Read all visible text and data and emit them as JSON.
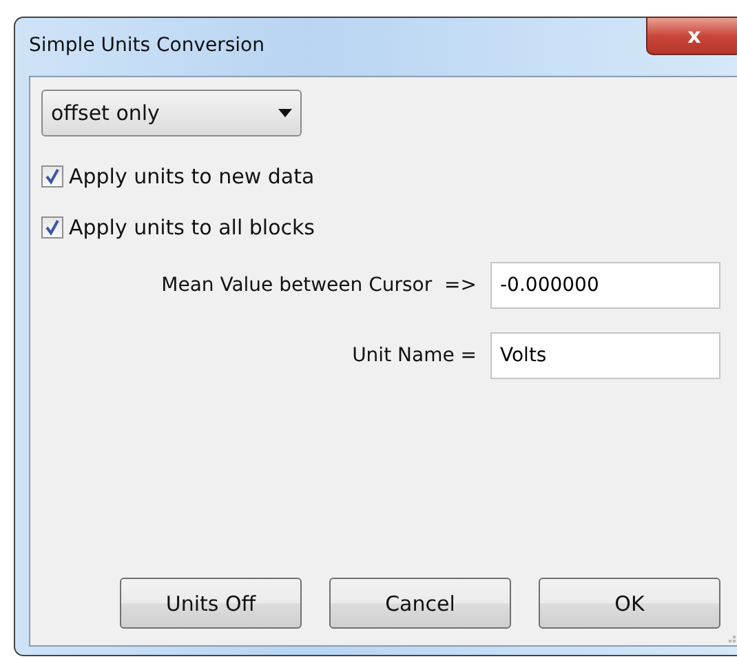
{
  "window": {
    "title": "Simple Units Conversion",
    "close_label": "x"
  },
  "mode_dropdown": {
    "value": "offset only"
  },
  "options": [
    {
      "label": "Apply units to new data",
      "checked": true
    },
    {
      "label": "Apply units to all blocks",
      "checked": true
    }
  ],
  "fields": [
    {
      "label": "Mean Value between Cursor  =>",
      "value": "-0.000000"
    },
    {
      "label": "Unit Name =",
      "value": "Volts"
    }
  ],
  "buttons": [
    "Units Off",
    "Cancel",
    "OK"
  ]
}
